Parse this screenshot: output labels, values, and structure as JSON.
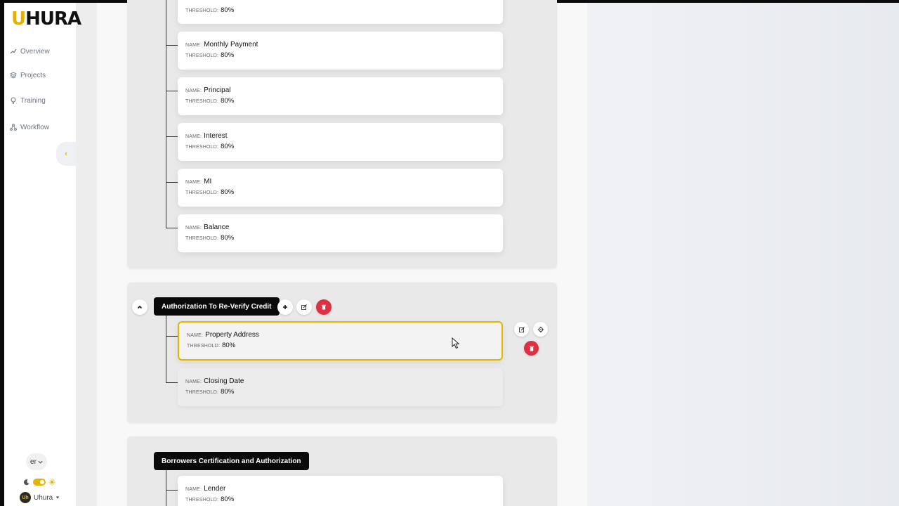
{
  "app": {
    "logo": "UHURA"
  },
  "sidebar": {
    "items": [
      {
        "label": "Overview",
        "icon": "chart-line-icon"
      },
      {
        "label": "Projects",
        "icon": "layers-icon"
      },
      {
        "label": "Training",
        "icon": "lightbulb-icon"
      },
      {
        "label": "Workflow",
        "icon": "workflow-icon"
      }
    ],
    "language": "er",
    "user": "Uhura",
    "theme_toggle": "on"
  },
  "labels": {
    "name": "NAME:",
    "threshold": "THRESHOLD:"
  },
  "top_section": {
    "fields": [
      {
        "name": "",
        "threshold": "80%"
      },
      {
        "name": "Monthly Payment",
        "threshold": "80%"
      },
      {
        "name": "Principal",
        "threshold": "80%"
      },
      {
        "name": "Interest",
        "threshold": "80%"
      },
      {
        "name": "MI",
        "threshold": "80%"
      },
      {
        "name": "Balance",
        "threshold": "80%"
      }
    ]
  },
  "auth_section": {
    "title": "Authorization To Re-Verify Credit",
    "fields": [
      {
        "name": "Property Address",
        "threshold": "80%",
        "selected": true
      },
      {
        "name": "Closing Date",
        "threshold": "80%"
      }
    ]
  },
  "borrowers_section": {
    "title": "Borrowers Certification and Authorization",
    "fields": [
      {
        "name": "Lender",
        "threshold": "80%"
      }
    ]
  },
  "colors": {
    "accent": "#e3b400",
    "danger": "#dc3142",
    "title_bg": "#0a0a0a"
  }
}
